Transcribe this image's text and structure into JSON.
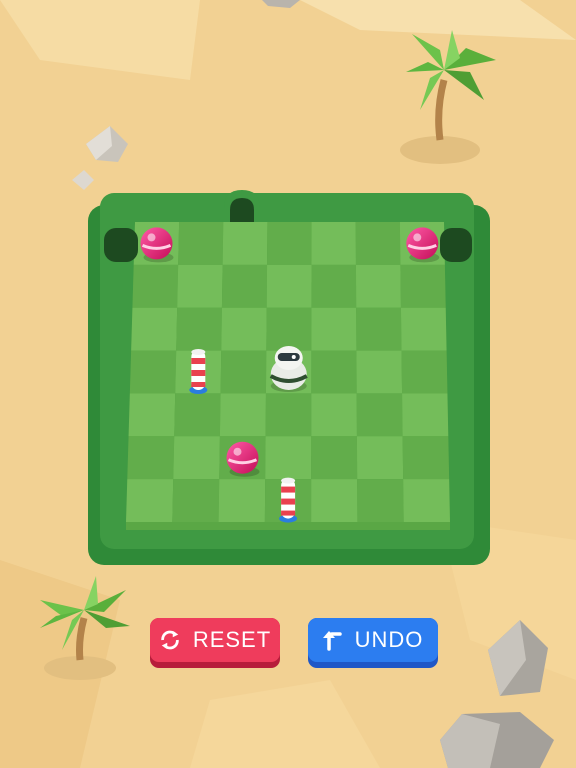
{
  "buttons": {
    "reset": {
      "label": "RESET",
      "icon": "refresh-icon",
      "color": "#ef3c5c"
    },
    "undo": {
      "label": "UNDO",
      "icon": "undo-arrow-icon",
      "color": "#2c7df0"
    }
  },
  "board": {
    "rows": 7,
    "cols": 7,
    "light_color": "#74bd5a",
    "dark_color": "#62ad4b",
    "frame_color": "#3f9a43"
  },
  "pieces": {
    "balls": [
      {
        "row": 0,
        "col": 0,
        "color": "#e8176b"
      },
      {
        "row": 0,
        "col": 6,
        "color": "#e8176b"
      },
      {
        "row": 5,
        "col": 2,
        "color": "#e8176b"
      }
    ],
    "posts": [
      {
        "row": 3,
        "col": 1
      },
      {
        "row": 6,
        "col": 3
      }
    ],
    "robot": {
      "row": 3,
      "col": 3
    }
  },
  "exits": [
    "top-center",
    "left",
    "right"
  ]
}
